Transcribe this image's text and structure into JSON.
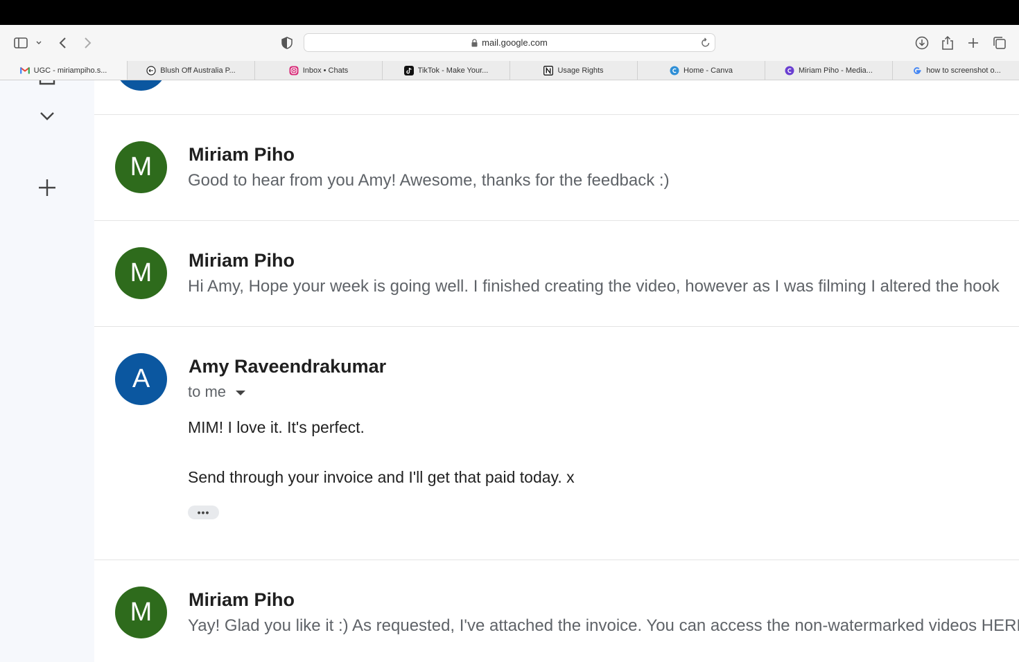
{
  "browser": {
    "url": "mail.google.com",
    "tabs": [
      {
        "label": "UGC - miriampiho.s...",
        "icon": "gmail-icon",
        "active": true
      },
      {
        "label": "Blush Off Australia P...",
        "icon": "blush-icon"
      },
      {
        "label": "Inbox • Chats",
        "icon": "instagram-icon"
      },
      {
        "label": "TikTok - Make Your...",
        "icon": "tiktok-icon"
      },
      {
        "label": "Usage Rights",
        "icon": "notion-icon"
      },
      {
        "label": "Home - Canva",
        "icon": "canva-icon"
      },
      {
        "label": "Miriam Piho - Media...",
        "icon": "canva-icon"
      },
      {
        "label": "how to screenshot o...",
        "icon": "google-icon"
      }
    ]
  },
  "colors": {
    "avatar_m": "#2e6b1c",
    "avatar_a": "#0b57a0",
    "rail_bg": "#f6f8fc"
  },
  "thread": {
    "messages": [
      {
        "avatar_letter": "M",
        "sender": "Miriam Piho",
        "snippet": "Good to hear from you Amy! Awesome, thanks for the feedback :)"
      },
      {
        "avatar_letter": "M",
        "sender": "Miriam Piho",
        "snippet": "Hi Amy, Hope your week is going well. I finished creating the video, however as I was filming I altered the hook"
      },
      {
        "avatar_letter": "A",
        "sender": "Amy Raveendrakumar",
        "recipient": "to me",
        "body": [
          "MIM! I love it. It's perfect.",
          "Send through your invoice and I'll get that paid today. x"
        ],
        "more": "•••"
      },
      {
        "avatar_letter": "M",
        "sender": "Miriam Piho",
        "snippet": "Yay! Glad you like it :) As requested, I've attached the invoice. You can access the non-watermarked videos HERE"
      }
    ]
  }
}
